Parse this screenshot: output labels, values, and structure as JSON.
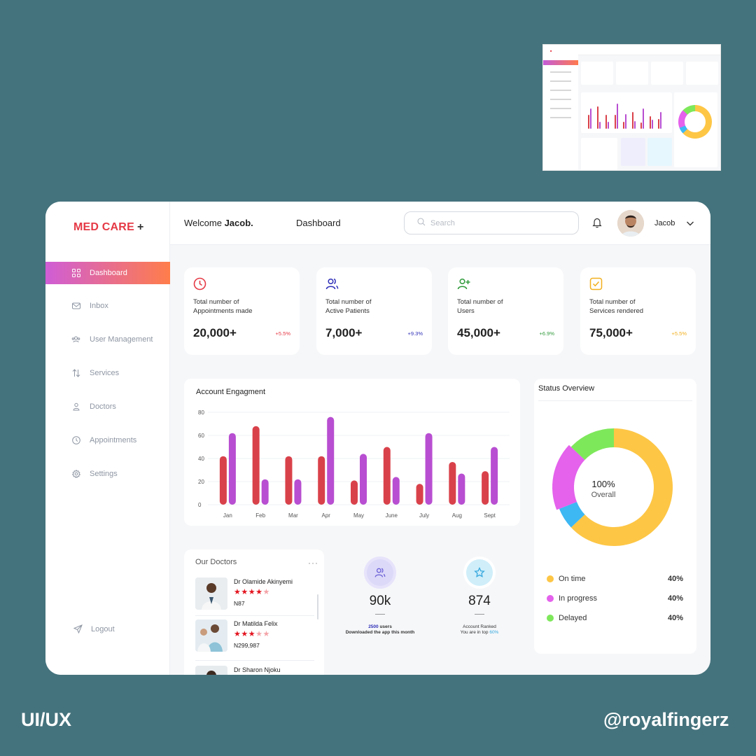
{
  "brand": {
    "name": "MED CARE",
    "plus": "+"
  },
  "header": {
    "welcome_prefix": "Welcome",
    "user_first": "Jacob.",
    "page_title": "Dashboard",
    "search_placeholder": "Search",
    "username": "Jacob"
  },
  "sidebar": {
    "items": [
      {
        "label": "Dashboard",
        "icon": "grid-icon",
        "active": true
      },
      {
        "label": "Inbox",
        "icon": "mail-icon"
      },
      {
        "label": "User Management",
        "icon": "users-icon"
      },
      {
        "label": "Services",
        "icon": "arrows-updown-icon"
      },
      {
        "label": "Doctors",
        "icon": "user-icon"
      },
      {
        "label": "Appointments",
        "icon": "clock-icon"
      },
      {
        "label": "Settings",
        "icon": "gear-icon"
      }
    ],
    "logout": "Logout"
  },
  "stats": [
    {
      "label_line1": "Total number of",
      "label_line2": "Appointments made",
      "value": "20,000+",
      "change": "+5.5%",
      "color": "#e53945",
      "icon": "clock-icon"
    },
    {
      "label_line1": "Total number of",
      "label_line2": "Active Patients",
      "value": "7,000+",
      "change": "+9.3%",
      "color": "#2f2fb8",
      "icon": "users-icon"
    },
    {
      "label_line1": "Total number of",
      "label_line2": "Users",
      "value": "45,000+",
      "change": "+6.9%",
      "color": "#2f9a3a",
      "icon": "user-plus-icon"
    },
    {
      "label_line1": "Total number of",
      "label_line2": "Services rendered",
      "value": "75,000+",
      "change": "+5.5%",
      "color": "#f2b01e",
      "icon": "check-square-icon"
    }
  ],
  "chart_data": {
    "type": "bar",
    "title": "Account Engagment",
    "categories": [
      "Jan",
      "Feb",
      "Mar",
      "Apr",
      "May",
      "June",
      "July",
      "Aug",
      "Sept"
    ],
    "series": [
      {
        "values": [
          42,
          68,
          42,
          42,
          21,
          50,
          18,
          37,
          29
        ],
        "color": "#d9414a"
      },
      {
        "values": [
          62,
          22,
          22,
          76,
          44,
          24,
          62,
          27,
          50
        ],
        "color": "#b84ed1"
      }
    ],
    "yticks": [
      0,
      20,
      40,
      60,
      80
    ],
    "ylim": [
      0,
      80
    ],
    "grid": true
  },
  "status": {
    "title": "Status Overview",
    "center_value": "100%",
    "center_label": "Overall",
    "segments": [
      {
        "label": "On time",
        "percent_text": "40%",
        "color": "#fdc645",
        "share": 63
      },
      {
        "label": "In progress",
        "percent_text": "40%",
        "color": "#e462ec",
        "share": 18
      },
      {
        "label": "Delayed",
        "percent_text": "40%",
        "color": "#7ee85b",
        "share": 13
      }
    ],
    "extra_segment": {
      "color": "#3db8f3",
      "share": 6
    }
  },
  "doctors": {
    "title": "Our Doctors",
    "more": "···",
    "list": [
      {
        "name": "Dr Olamide Akinyemi",
        "stars": 4,
        "fee": "N87"
      },
      {
        "name": "Dr Matilda Felix",
        "stars": 3,
        "fee": "N299,987"
      },
      {
        "name": "Dr Sharon Njoku",
        "stars": 0,
        "fee": ""
      }
    ]
  },
  "downloads": {
    "value": "90k",
    "count": "2500",
    "count_suffix": " users",
    "caption": "Downloaded the app this month",
    "bg": "#efeefc",
    "icon": "users-icon"
  },
  "ranked": {
    "value": "874",
    "caption": "Account Ranked",
    "caption2_prefix": "You are in top ",
    "caption2_pct": "60%",
    "bg": "#e6f7fd",
    "icon": "star-icon"
  },
  "footer": {
    "left": "UI/UX",
    "right": "@royalfingerz"
  }
}
